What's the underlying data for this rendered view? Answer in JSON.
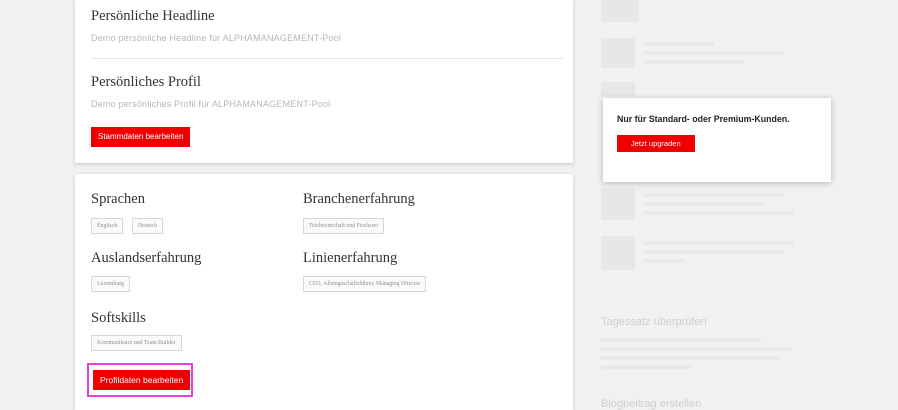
{
  "profile_card": {
    "headline_title": "Persönliche Headline",
    "headline_text": "Demo persönliche Headline für ALPHAMANAGEMENT-Pool",
    "profile_title": "Persönliches Profil",
    "profile_text": "Demo persönliches Profil für ALPHAMANAGEMENT-Pool",
    "edit_master_data_button": "Stammdaten bearbeiten"
  },
  "skills_card": {
    "languages": {
      "title": "Sprachen",
      "tags": [
        "Englisch",
        "Deutsch"
      ]
    },
    "industry": {
      "title": "Branchenerfahrung",
      "tags": [
        "Teichwirtschaft und Fischerei"
      ]
    },
    "abroad": {
      "title": "Auslandserfahrung",
      "tags": [
        "Luxemburg"
      ]
    },
    "line": {
      "title": "Linienerfahrung",
      "tags": [
        "CEO, Alleingeschäftsführer, Managing Director"
      ]
    },
    "softskills": {
      "title": "Softskills",
      "tags": [
        "Kommunikator und Team Builder"
      ]
    },
    "edit_profile_button": "Profildaten bearbeiten"
  },
  "upgrade_card": {
    "title": "Nur für Standard- oder Premium-Kunden.",
    "button": "Jetzt upgraden"
  },
  "sidebar_faded": {
    "daily_rate_heading": "Tagessatz überprüfen",
    "blog_heading": "Blogbeitrag erstellen"
  }
}
